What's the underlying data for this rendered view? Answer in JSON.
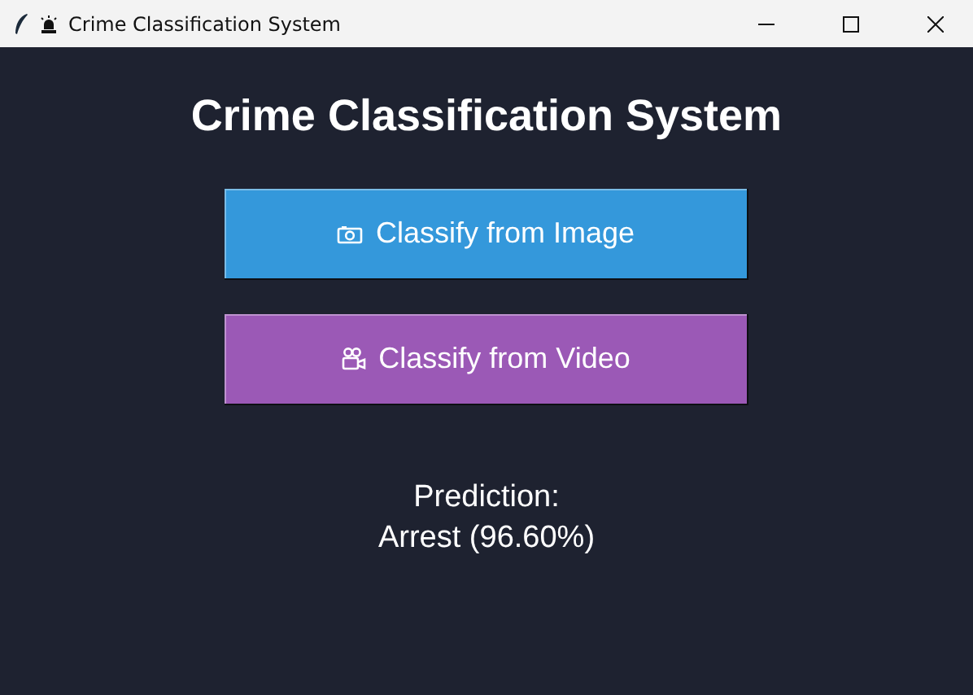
{
  "window": {
    "title": "Crime Classification System"
  },
  "heading": "Crime Classification System",
  "buttons": [
    {
      "label": "Classify from Image",
      "kind": "image",
      "color": "#3498db"
    },
    {
      "label": "Classify from Video",
      "kind": "video",
      "color": "#9b59b6"
    }
  ],
  "prediction": {
    "label": "Prediction:",
    "value": "Arrest (96.60%)"
  }
}
